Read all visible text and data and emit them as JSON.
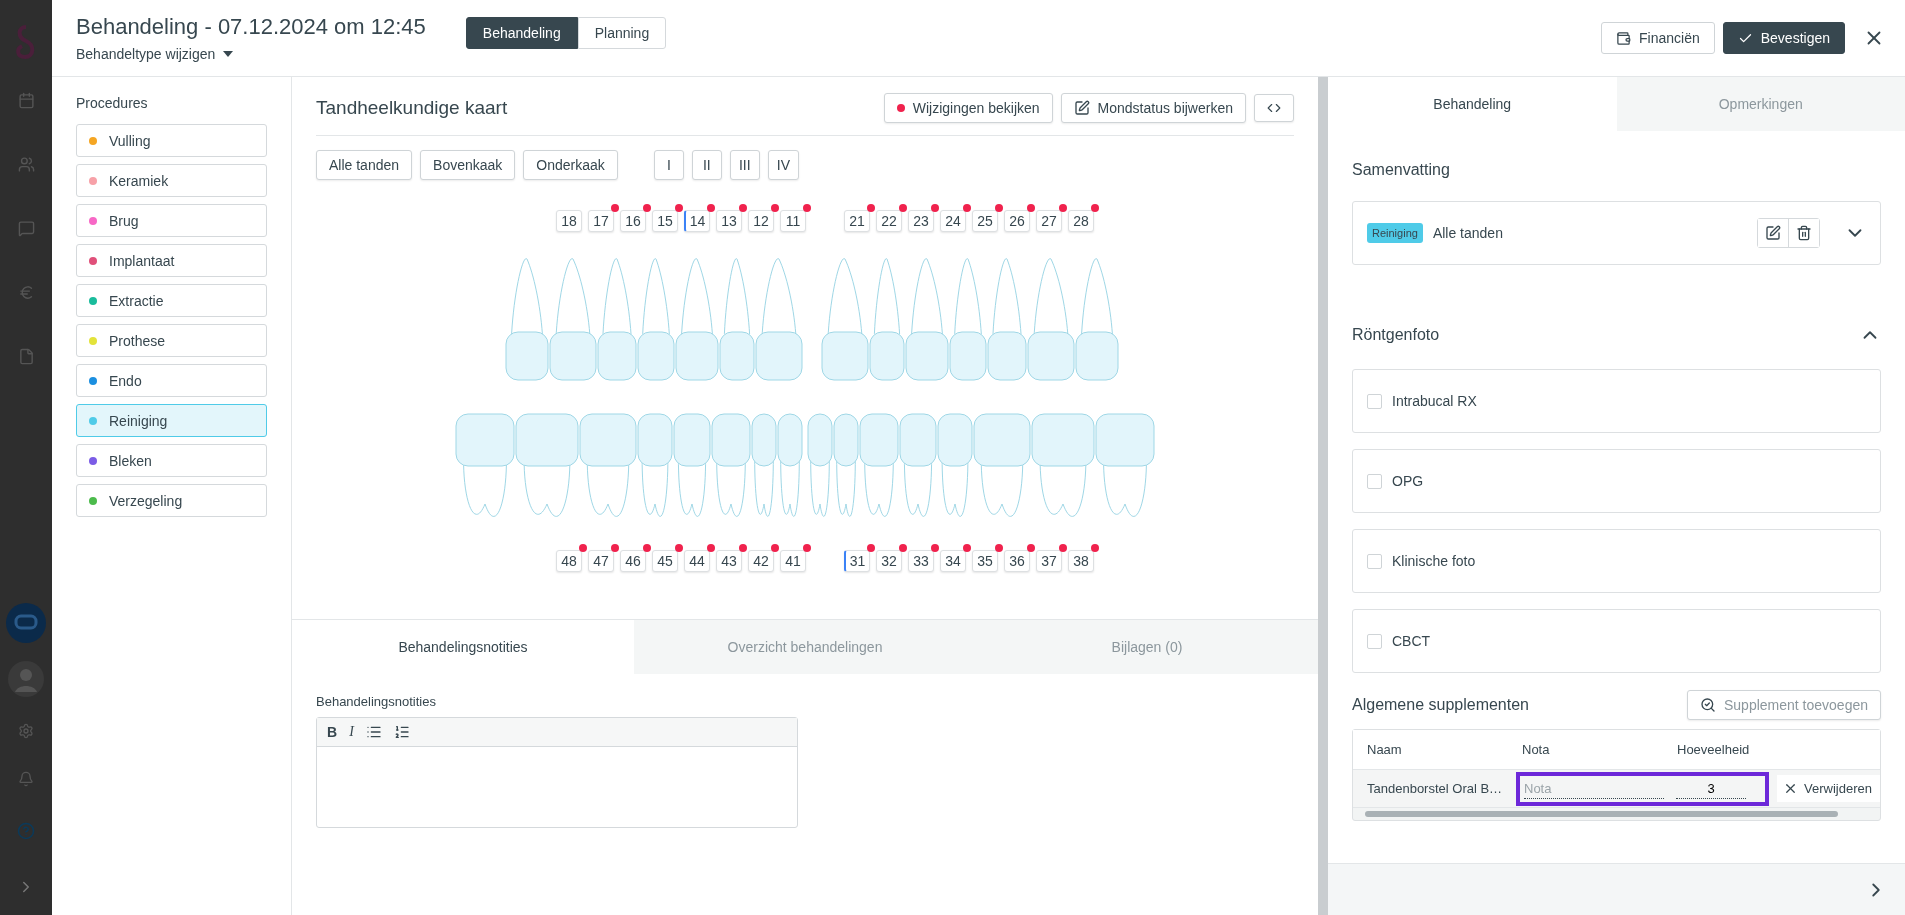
{
  "header": {
    "title": "Behandeling - 07.12.2024 om 12:45",
    "subtitle": "Behandeltype wijzigen",
    "tabs": [
      {
        "label": "Behandeling",
        "selected": true
      },
      {
        "label": "Planning",
        "selected": false
      }
    ],
    "actions": [
      {
        "label": "Financiën",
        "kind": "finance"
      },
      {
        "label": "Bevestigen",
        "kind": "confirm"
      }
    ]
  },
  "procedures": {
    "title": "Procedures",
    "items": [
      {
        "label": "Vulling",
        "color": "#f5a623",
        "selected": false
      },
      {
        "label": "Keramiek",
        "color": "#f7a1a8",
        "selected": false
      },
      {
        "label": "Brug",
        "color": "#f768c6",
        "selected": false
      },
      {
        "label": "Implantaat",
        "color": "#e0507a",
        "selected": false
      },
      {
        "label": "Extractie",
        "color": "#1abc9c",
        "selected": false
      },
      {
        "label": "Prothese",
        "color": "#e3e33a",
        "selected": false
      },
      {
        "label": "Endo",
        "color": "#1b8fe0",
        "selected": false
      },
      {
        "label": "Reiniging",
        "color": "#4fcbe8",
        "selected": true
      },
      {
        "label": "Bleken",
        "color": "#7b5ce6",
        "selected": false
      },
      {
        "label": "Verzegeling",
        "color": "#4cbb4c",
        "selected": false
      }
    ]
  },
  "chart": {
    "title": "Tandheelkundige kaart",
    "actions": [
      {
        "label": "Wijzigingen bekijken",
        "kind": "changes"
      },
      {
        "label": "Mondstatus bijwerken",
        "kind": "edit"
      },
      {
        "kind": "code"
      }
    ],
    "filters": [
      {
        "label": "Alle tanden",
        "kind": "jaw"
      },
      {
        "label": "Bovenkaak",
        "kind": "jaw"
      },
      {
        "label": "Onderkaak",
        "kind": "jaw"
      },
      {
        "label": "I",
        "kind": "quadrant"
      },
      {
        "label": "II",
        "kind": "quadrant"
      },
      {
        "label": "III",
        "kind": "quadrant"
      },
      {
        "label": "IV",
        "kind": "quadrant"
      }
    ],
    "upper": [
      [
        {
          "label": "18",
          "marked": false,
          "focused": false
        },
        {
          "label": "17",
          "marked": true,
          "focused": false
        },
        {
          "label": "16",
          "marked": true,
          "focused": false
        },
        {
          "label": "15",
          "marked": true,
          "focused": false
        },
        {
          "label": "14",
          "marked": true,
          "focused": true
        },
        {
          "label": "13",
          "marked": true,
          "focused": false
        },
        {
          "label": "12",
          "marked": true,
          "focused": false
        },
        {
          "label": "11",
          "marked": true,
          "focused": false
        }
      ],
      [
        {
          "label": "21",
          "marked": true,
          "focused": false
        },
        {
          "label": "22",
          "marked": true,
          "focused": false
        },
        {
          "label": "23",
          "marked": true,
          "focused": false
        },
        {
          "label": "24",
          "marked": true,
          "focused": false
        },
        {
          "label": "25",
          "marked": true,
          "focused": false
        },
        {
          "label": "26",
          "marked": true,
          "focused": false
        },
        {
          "label": "27",
          "marked": true,
          "focused": false
        },
        {
          "label": "28",
          "marked": true,
          "focused": false
        }
      ]
    ],
    "lower": [
      [
        {
          "label": "48",
          "marked": true,
          "focused": false
        },
        {
          "label": "47",
          "marked": true,
          "focused": false
        },
        {
          "label": "46",
          "marked": true,
          "focused": false
        },
        {
          "label": "45",
          "marked": true,
          "focused": false
        },
        {
          "label": "44",
          "marked": true,
          "focused": false
        },
        {
          "label": "43",
          "marked": true,
          "focused": false
        },
        {
          "label": "42",
          "marked": true,
          "focused": false
        },
        {
          "label": "41",
          "marked": true,
          "focused": false
        }
      ],
      [
        {
          "label": "31",
          "marked": true,
          "focused": true
        },
        {
          "label": "32",
          "marked": true,
          "focused": false
        },
        {
          "label": "33",
          "marked": true,
          "focused": false
        },
        {
          "label": "34",
          "marked": true,
          "focused": false
        },
        {
          "label": "35",
          "marked": true,
          "focused": false
        },
        {
          "label": "36",
          "marked": true,
          "focused": false
        },
        {
          "label": "37",
          "marked": true,
          "focused": false
        },
        {
          "label": "38",
          "marked": true,
          "focused": false
        }
      ]
    ]
  },
  "notes_tabs": [
    {
      "label": "Behandelingsnotities",
      "selected": true
    },
    {
      "label": "Overzicht behandelingen",
      "selected": false
    },
    {
      "label": "Bijlagen (0)",
      "selected": false
    }
  ],
  "notes": {
    "label": "Behandelingsnotities",
    "toolbar": [
      "B",
      "I"
    ]
  },
  "side_tabs": [
    {
      "label": "Behandeling",
      "selected": true
    },
    {
      "label": "Opmerkingen",
      "selected": false
    }
  ],
  "summary": {
    "title": "Samenvatting",
    "tag": "Reiniging",
    "text": "Alle tanden"
  },
  "xray": {
    "title": "Röntgenfoto",
    "expanded": true,
    "options": [
      {
        "label": "Intrabucal RX",
        "checked": false
      },
      {
        "label": "OPG",
        "checked": false
      },
      {
        "label": "Klinische foto",
        "checked": false
      },
      {
        "label": "CBCT",
        "checked": false
      }
    ]
  },
  "supplements": {
    "title": "Algemene supplementen",
    "add": "Supplement toevoegen",
    "columns": [
      "Naam",
      "Nota",
      "Hoeveelheid"
    ],
    "rows": [
      {
        "name": "Tandenborstel Oral B…",
        "note_placeholder": "Nota",
        "quantity": "3",
        "action": "Verwijderen",
        "highlighted": true
      }
    ]
  }
}
